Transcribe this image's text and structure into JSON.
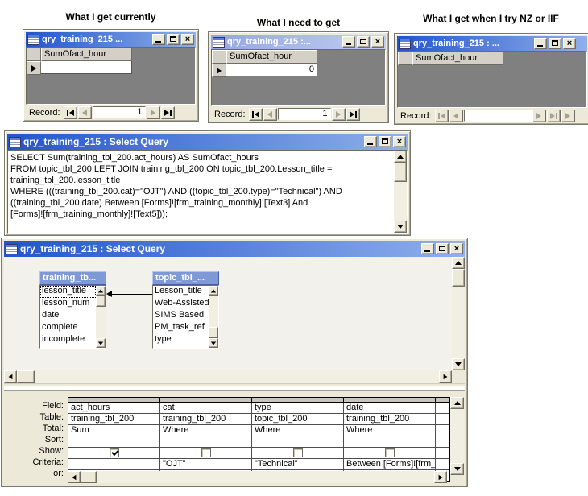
{
  "captions": {
    "left": "What I get currently",
    "middle": "What I need to get",
    "right": "What I get when I try NZ or IIF"
  },
  "record_label": "Record:",
  "icons": {
    "close": "×",
    "minimize": "minimize-glyph",
    "maximize": "maximize-glyph",
    "record_first": "first-record-arrow",
    "record_prev": "previous-record-arrow",
    "record_next": "next-record-arrow",
    "record_last": "last-record-arrow"
  },
  "datasheet_windows": [
    {
      "title": "qry_training_215 ...",
      "column": "SumOfact_hour",
      "value": "",
      "record_number": "1"
    },
    {
      "title": "qry_training_215 :...",
      "column": "SumOfact_hour",
      "value": "0",
      "record_number": "1"
    },
    {
      "title": "qry_training_215 : ...",
      "column": "SumOfact_hour",
      "record_number": ""
    }
  ],
  "sql_window": {
    "title": "qry_training_215 : Select Query",
    "sql_lines": [
      "SELECT Sum(training_tbl_200.act_hours) AS SumOfact_hours",
      "FROM topic_tbl_200 LEFT JOIN training_tbl_200 ON topic_tbl_200.Lesson_title =",
      "training_tbl_200.lesson_title",
      "WHERE (((training_tbl_200.cat)=\"OJT\") AND ((topic_tbl_200.type)=\"Technical\") AND",
      "((training_tbl_200.date) Between [Forms]![frm_training_monthly]![Text3] And",
      "[Forms]![frm_training_monthly]![Text5]));"
    ]
  },
  "design_window": {
    "title": "qry_training_215 : Select Query",
    "tables": [
      {
        "name": "training_tb...",
        "selected_field": "lesson_title",
        "fields": [
          "lesson_title",
          "lesson_num",
          "date",
          "complete",
          "incomplete"
        ]
      },
      {
        "name": "topic_tbl_...",
        "fields": [
          "Lesson_title",
          "Web-Assisted",
          "SIMS Based",
          "PM_task_ref",
          "type"
        ]
      }
    ],
    "join": {
      "type": "left-join-arrow"
    },
    "grid": {
      "row_labels": [
        "Field:",
        "Table:",
        "Total:",
        "Sort:",
        "Show:",
        "Criteria:",
        "or:"
      ],
      "columns": [
        {
          "field": "act_hours",
          "table": "training_tbl_200",
          "total": "Sum",
          "sort": "",
          "show": true,
          "criteria": "",
          "or": ""
        },
        {
          "field": "cat",
          "table": "training_tbl_200",
          "total": "Where",
          "sort": "",
          "show": false,
          "criteria": "\"OJT\"",
          "or": ""
        },
        {
          "field": "type",
          "table": "topic_tbl_200",
          "total": "Where",
          "sort": "",
          "show": false,
          "criteria": "\"Technical\"",
          "or": ""
        },
        {
          "field": "date",
          "table": "training_tbl_200",
          "total": "Where",
          "sort": "",
          "show": false,
          "criteria": "Between [Forms]![frm_",
          "or": ""
        }
      ]
    }
  },
  "colors": {
    "title_active_start": "#2255cc",
    "title_active_end": "#8fb0ea",
    "title_inactive_start": "#93a7e0",
    "title_inactive_end": "#c0cdf0",
    "window_chrome": "#ECE9D8",
    "datasheet_background": "#808080",
    "field_list_header": "#7E99D6"
  }
}
